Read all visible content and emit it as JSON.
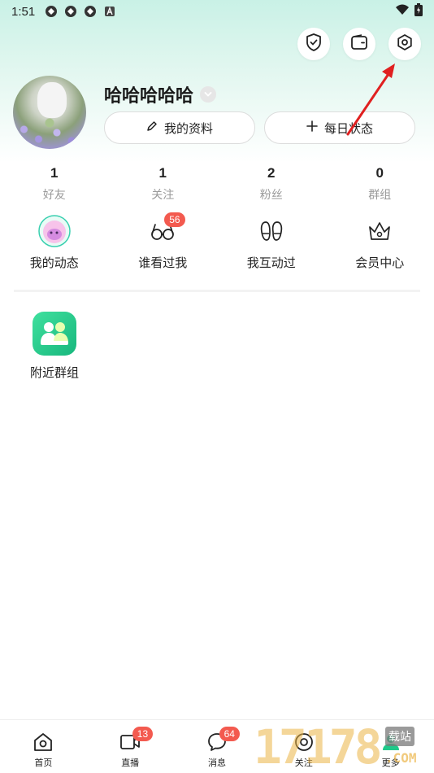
{
  "status_bar": {
    "time": "1:51"
  },
  "profile": {
    "username": "哈哈哈哈哈",
    "my_profile_label": "我的资料",
    "daily_status_label": "每日状态"
  },
  "stats": [
    {
      "value": "1",
      "label": "好友"
    },
    {
      "value": "1",
      "label": "关注"
    },
    {
      "value": "2",
      "label": "粉丝"
    },
    {
      "value": "0",
      "label": "群组"
    }
  ],
  "features": [
    {
      "label": "我的动态",
      "icon": "moments-avatar-icon"
    },
    {
      "label": "谁看过我",
      "icon": "glasses-icon",
      "badge": "56"
    },
    {
      "label": "我互动过",
      "icon": "footprints-icon"
    },
    {
      "label": "会员中心",
      "icon": "crown-icon"
    }
  ],
  "nearby": {
    "label": "附近群组",
    "icon": "group-icon"
  },
  "bottom_nav": [
    {
      "label": "首页",
      "icon": "home-icon"
    },
    {
      "label": "直播",
      "icon": "video-icon",
      "badge": "13"
    },
    {
      "label": "消息",
      "icon": "message-icon",
      "badge": "64"
    },
    {
      "label": "关注",
      "icon": "follow-icon"
    },
    {
      "label": "更多",
      "icon": "profile-icon"
    }
  ],
  "watermark": {
    "digits": "17178",
    "site": "载站",
    "com": ".COM"
  },
  "colors": {
    "accent": "#1fc98a",
    "badge": "#f35a4f",
    "arrow": "#e02020"
  }
}
